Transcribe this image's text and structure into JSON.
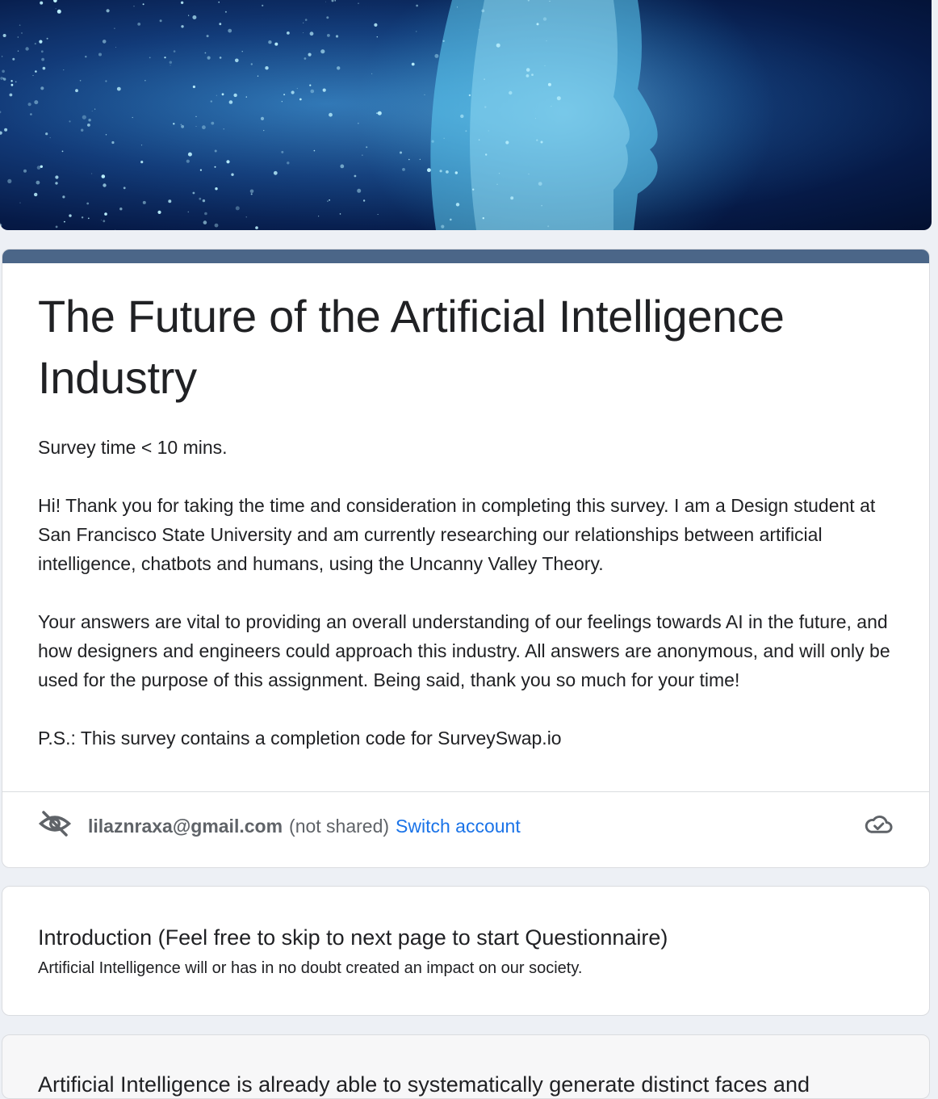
{
  "form": {
    "title": "The Future of the Artificial Intelligence Industry",
    "description": "Survey time < 10 mins.\n\nHi! Thank you for taking the time and consideration in completing this survey. I am a Design student at San Francisco State University and am currently researching our relationships between artificial intelligence, chatbots and humans, using the Uncanny Valley Theory.\n\nYour answers are vital to providing an overall understanding of our feelings towards AI in the future, and how designers and engineers could approach this industry. All answers are anonymous, and will only be used for the purpose of this assignment. Being said, thank you so much for your time!\n\nP.S.: This survey contains a completion code for SurveySwap.io",
    "accent_color": "#4b6688"
  },
  "account": {
    "email": "lilaznraxa@gmail.com",
    "not_shared": "(not shared)",
    "switch_label": "Switch account",
    "privacy_icon": "eye-off-icon",
    "save_icon": "cloud-check-icon",
    "link_color": "#1a73e8"
  },
  "intro": {
    "title": "Introduction (Feel free to skip to next page to start Questionnaire)",
    "description": "Artificial Intelligence will or has in no doubt created an impact on our society."
  },
  "next_section": {
    "text": "Artificial Intelligence is already able to systematically generate distinct faces and"
  }
}
